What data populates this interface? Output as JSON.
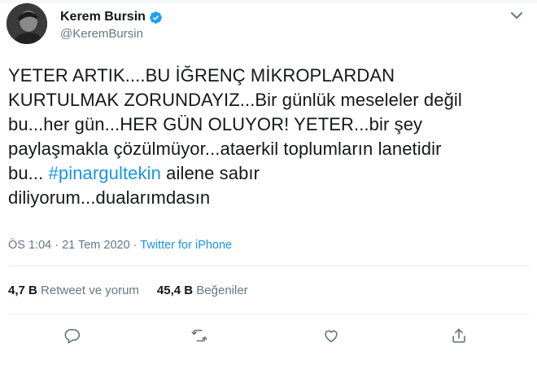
{
  "user": {
    "display_name": "Kerem Bursin",
    "handle": "@KeremBursin",
    "verified": true
  },
  "tweet": {
    "lines": [
      "YETER ARTIK....BU İĞRENÇ MİKROPLARDAN",
      "KURTULMAK ZORUNDAYIZ...Bir günlük meseleler değil",
      "bu...her gün...HER GÜN OLUYOR! YETER...bir şey",
      "paylaşmakla çözülmüyor...ataerkil toplumların lanetidir"
    ],
    "line5_prefix": "bu... ",
    "hashtag": "#pinargultekin",
    "line5_suffix": " ailene sabır",
    "line6": "diliyorum...dualarımdasın"
  },
  "meta": {
    "time_date": "ÖS 1:04 · 21 Tem 2020 · ",
    "source": "Twitter for iPhone"
  },
  "stats": {
    "retweets_count": "4,7 B",
    "retweets_label": "Retweet ve yorum",
    "likes_count": "45,4 B",
    "likes_label": "Beğeniler"
  },
  "colors": {
    "accent": "#1b95e0",
    "secondary_text": "#657786",
    "primary_text": "#14171a",
    "divider": "#e6ecf0"
  },
  "icons": [
    "verified-badge-icon",
    "chevron-down-icon",
    "reply-icon",
    "retweet-icon",
    "like-icon",
    "share-icon"
  ]
}
